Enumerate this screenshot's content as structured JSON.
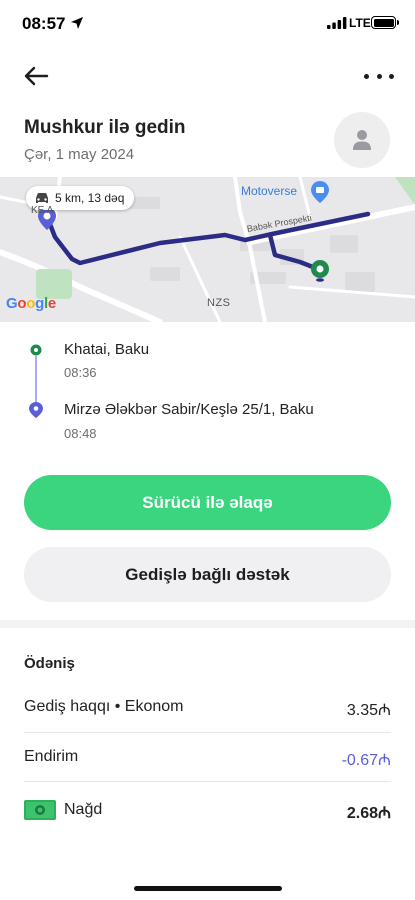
{
  "status_bar": {
    "time": "08:57",
    "network": "LTE",
    "icons": [
      "location-arrow-icon",
      "signal-icon",
      "battery-icon"
    ]
  },
  "header": {
    "title": "Mushkur ilə gedin",
    "date": "Çər, 1 may 2024",
    "icons": [
      "back-arrow-icon",
      "more-icon",
      "avatar-icon"
    ]
  },
  "map": {
    "route_chip": "5 km, 13 dəq",
    "labels": {
      "motoverse": "Motoverse",
      "street": "Babək Prospekti",
      "nzs": "NZS",
      "kesla": "KE   A"
    },
    "attribution": "Google",
    "colors": {
      "route": "#2b2c86",
      "origin_pin": "#1f8a4c",
      "destination_pin": "#5b5fd6"
    }
  },
  "stops": [
    {
      "name": "Khatai, Baku",
      "time": "08:36",
      "color": "#1f8a4c"
    },
    {
      "name": "Mirzə Ələkbər Sabir/Keşlə 25/1, Baku",
      "time": "08:48",
      "color": "#5b5fd6"
    }
  ],
  "actions": {
    "contact_driver": "Sürücü ilə əlaqə",
    "trip_support": "Gedişlə bağlı dəstək"
  },
  "payment": {
    "title": "Ödəniş",
    "rows": [
      {
        "label": "Gediş haqqı • Ekonom",
        "value": "3.35₼"
      },
      {
        "label": "Endirim",
        "value": "-0.67₼",
        "color": "#5b5fd6"
      },
      {
        "label": "Nağd",
        "value": "2.68₼",
        "icon": "cash-icon"
      }
    ]
  },
  "accent_colors": {
    "primary_button": "#3bd47f",
    "secondary_button": "#f0f0f2"
  }
}
